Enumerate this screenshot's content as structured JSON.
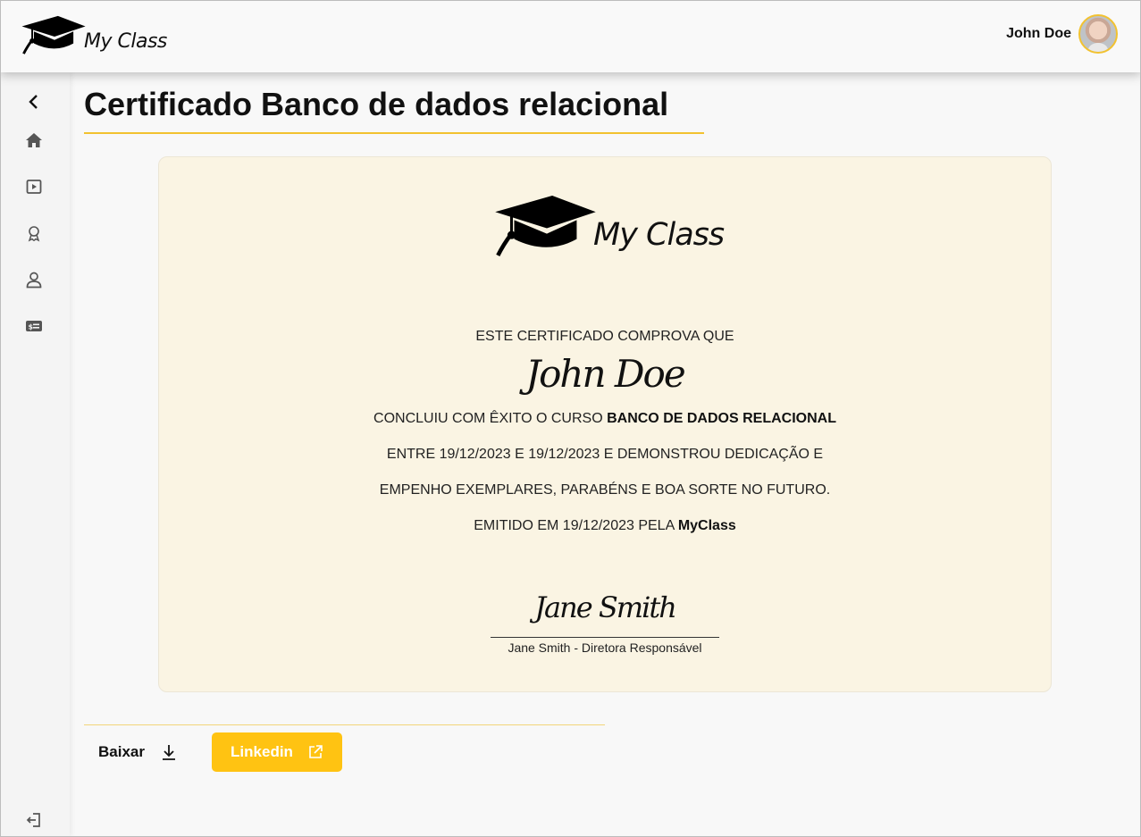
{
  "app": {
    "name": "My Class"
  },
  "header": {
    "user_name": "John Doe"
  },
  "sidebar": {
    "items": [
      {
        "icon": "chevron-left-icon"
      },
      {
        "icon": "home-icon"
      },
      {
        "icon": "play-icon"
      },
      {
        "icon": "award-icon"
      },
      {
        "icon": "user-icon"
      },
      {
        "icon": "payment-icon"
      },
      {
        "icon": "logout-icon"
      }
    ]
  },
  "page": {
    "title": "Certificado Banco de dados relacional"
  },
  "certificate": {
    "logo_text": "My Class",
    "intro": "ESTE CERTIFICADO COMPROVA QUE",
    "student_name": "John Doe",
    "completed_prefix": "CONCLUIU COM ÊXITO O CURSO ",
    "course_name": "BANCO DE DADOS RELACIONAL",
    "period_line": "ENTRE 19/12/2023 E 19/12/2023 E DEMONSTROU DEDICAÇÃO E",
    "praise_line": "EMPENHO EXEMPLARES, PARABÉNS E BOA SORTE NO FUTURO.",
    "issued_prefix": "EMITIDO EM 19/12/2023 PELA ",
    "issuer": "MyClass",
    "signature": "Jane Smith",
    "signer_caption": "Jane Smith - Diretora Responsável"
  },
  "actions": {
    "download_label": "Baixar",
    "linkedin_label": "Linkedin"
  },
  "colors": {
    "accent": "#ffc312",
    "certificate_background": "#faf4e3",
    "underline": "#f2c230"
  }
}
